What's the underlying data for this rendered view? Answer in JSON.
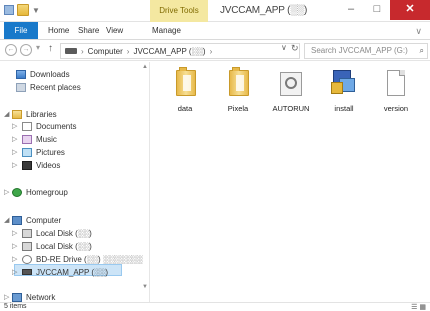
{
  "title_bar": {
    "context_tab": "Drive Tools",
    "window_title": "JVCCAM_APP (░░)",
    "minimize": "–",
    "maximize": "□",
    "close": "✕"
  },
  "ribbon": {
    "tabs": [
      "File",
      "Home",
      "Share",
      "View",
      "Manage"
    ],
    "expand": "∨"
  },
  "address": {
    "back": "←",
    "forward": "→",
    "up": "↑",
    "crumb_computer": "Computer",
    "crumb_drive": "JVCCAM_APP (░░)",
    "chevron": "›",
    "dropdown": "∨",
    "refresh": "↻",
    "search_placeholder": "Search JVCCAM_APP (G:)",
    "search_icon": "⌕"
  },
  "nav": {
    "favorites": [
      {
        "label": "Downloads",
        "icon": "download-icon"
      },
      {
        "label": "Recent places",
        "icon": "recent-places-icon"
      }
    ],
    "libraries_label": "Libraries",
    "libraries": [
      {
        "label": "Documents",
        "icon": "documents-icon"
      },
      {
        "label": "Music",
        "icon": "music-icon"
      },
      {
        "label": "Pictures",
        "icon": "pictures-icon"
      },
      {
        "label": "Videos",
        "icon": "videos-icon"
      }
    ],
    "homegroup_label": "Homegroup",
    "computer_label": "Computer",
    "drives": [
      {
        "label": "Local Disk (░░)",
        "icon": "local-disk-icon"
      },
      {
        "label": "Local Disk (░░)",
        "icon": "local-disk-icon"
      },
      {
        "label": "BD-RE Drive (░░) ░░░░░░░",
        "icon": "bd-drive-icon"
      },
      {
        "label": "JVCCAM_APP (░░)",
        "icon": "usb-drive-icon"
      }
    ],
    "network_label": "Network"
  },
  "files": [
    {
      "label": "data",
      "type": "folder"
    },
    {
      "label": "Pixela",
      "type": "folder"
    },
    {
      "label": "AUTORUN",
      "type": "autorun"
    },
    {
      "label": "install",
      "type": "installer"
    },
    {
      "label": "version",
      "type": "text"
    }
  ],
  "status": {
    "items": "5 items",
    "view_icons": "☰ ▦"
  },
  "colors": {
    "file_tab": "#1979ca",
    "context_tab": "#f4e8a1",
    "close_button": "#c7292d",
    "selection": "#cce4f7"
  }
}
